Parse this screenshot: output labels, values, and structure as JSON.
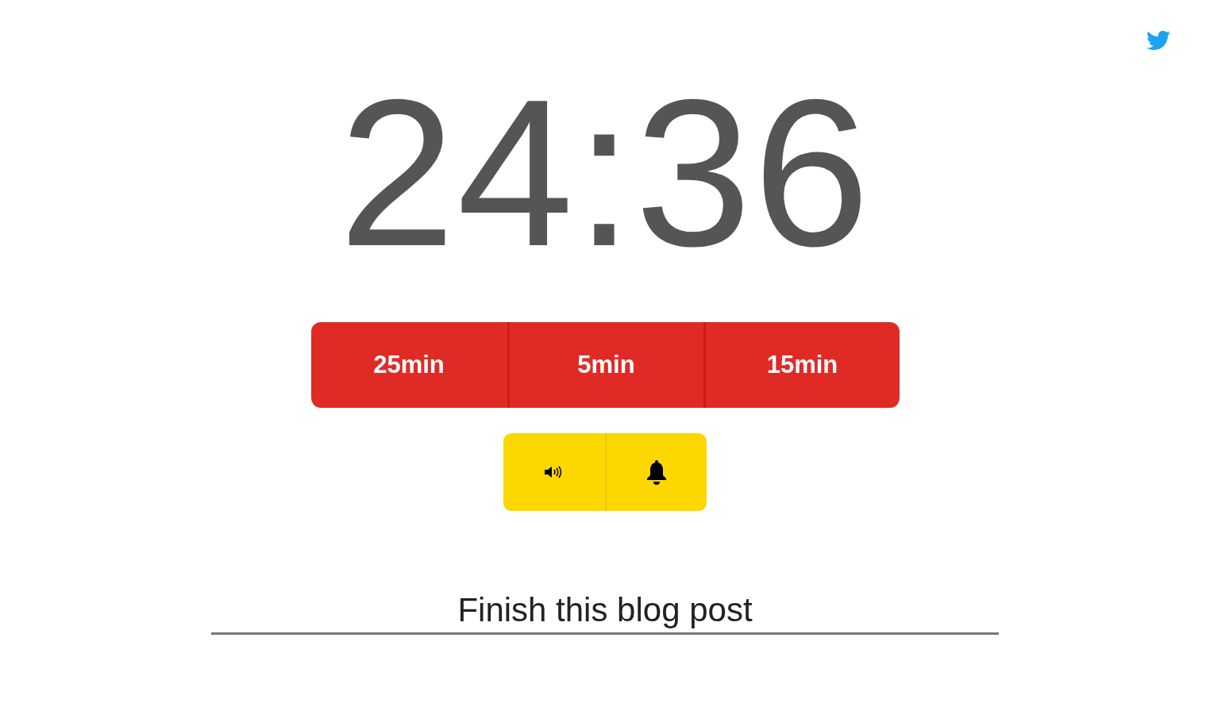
{
  "timer": {
    "time": "24:36"
  },
  "presets": [
    {
      "label": "25min"
    },
    {
      "label": "5min"
    },
    {
      "label": "15min"
    }
  ],
  "task": {
    "value": "Finish this blog post"
  }
}
